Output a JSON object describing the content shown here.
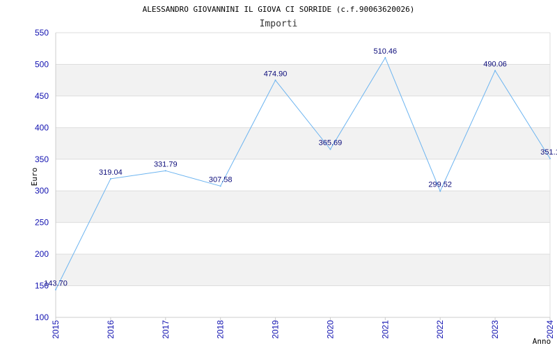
{
  "chart_data": {
    "type": "line",
    "title": "ALESSANDRO GIOVANNINI IL GIOVA CI SORRIDE (c.f.90063620026)",
    "subtitle": "Importi",
    "xlabel": "Anno",
    "ylabel": "Euro",
    "x": [
      "2015",
      "2016",
      "2017",
      "2018",
      "2019",
      "2020",
      "2021",
      "2022",
      "2023",
      "2024"
    ],
    "series": [
      {
        "values": [
          143.7,
          319.04,
          331.79,
          307.58,
          474.9,
          365.69,
          510.46,
          299.52,
          490.06,
          351.1
        ],
        "labels": [
          "143.70",
          "319.04",
          "331.79",
          "307.58",
          "474.90",
          "365.69",
          "510.46",
          "299.52",
          "490.06",
          "351.1"
        ],
        "color": "#6cb4f0"
      }
    ],
    "ylim": [
      100,
      550
    ],
    "yticks": [
      "100",
      "150",
      "200",
      "250",
      "300",
      "350",
      "400",
      "450",
      "500",
      "550"
    ],
    "grid": true,
    "band_color": "#f2f2f2",
    "grid_color": "#dddddd",
    "tick_color": "#1010b0",
    "label_color": "#0b0b7a"
  }
}
